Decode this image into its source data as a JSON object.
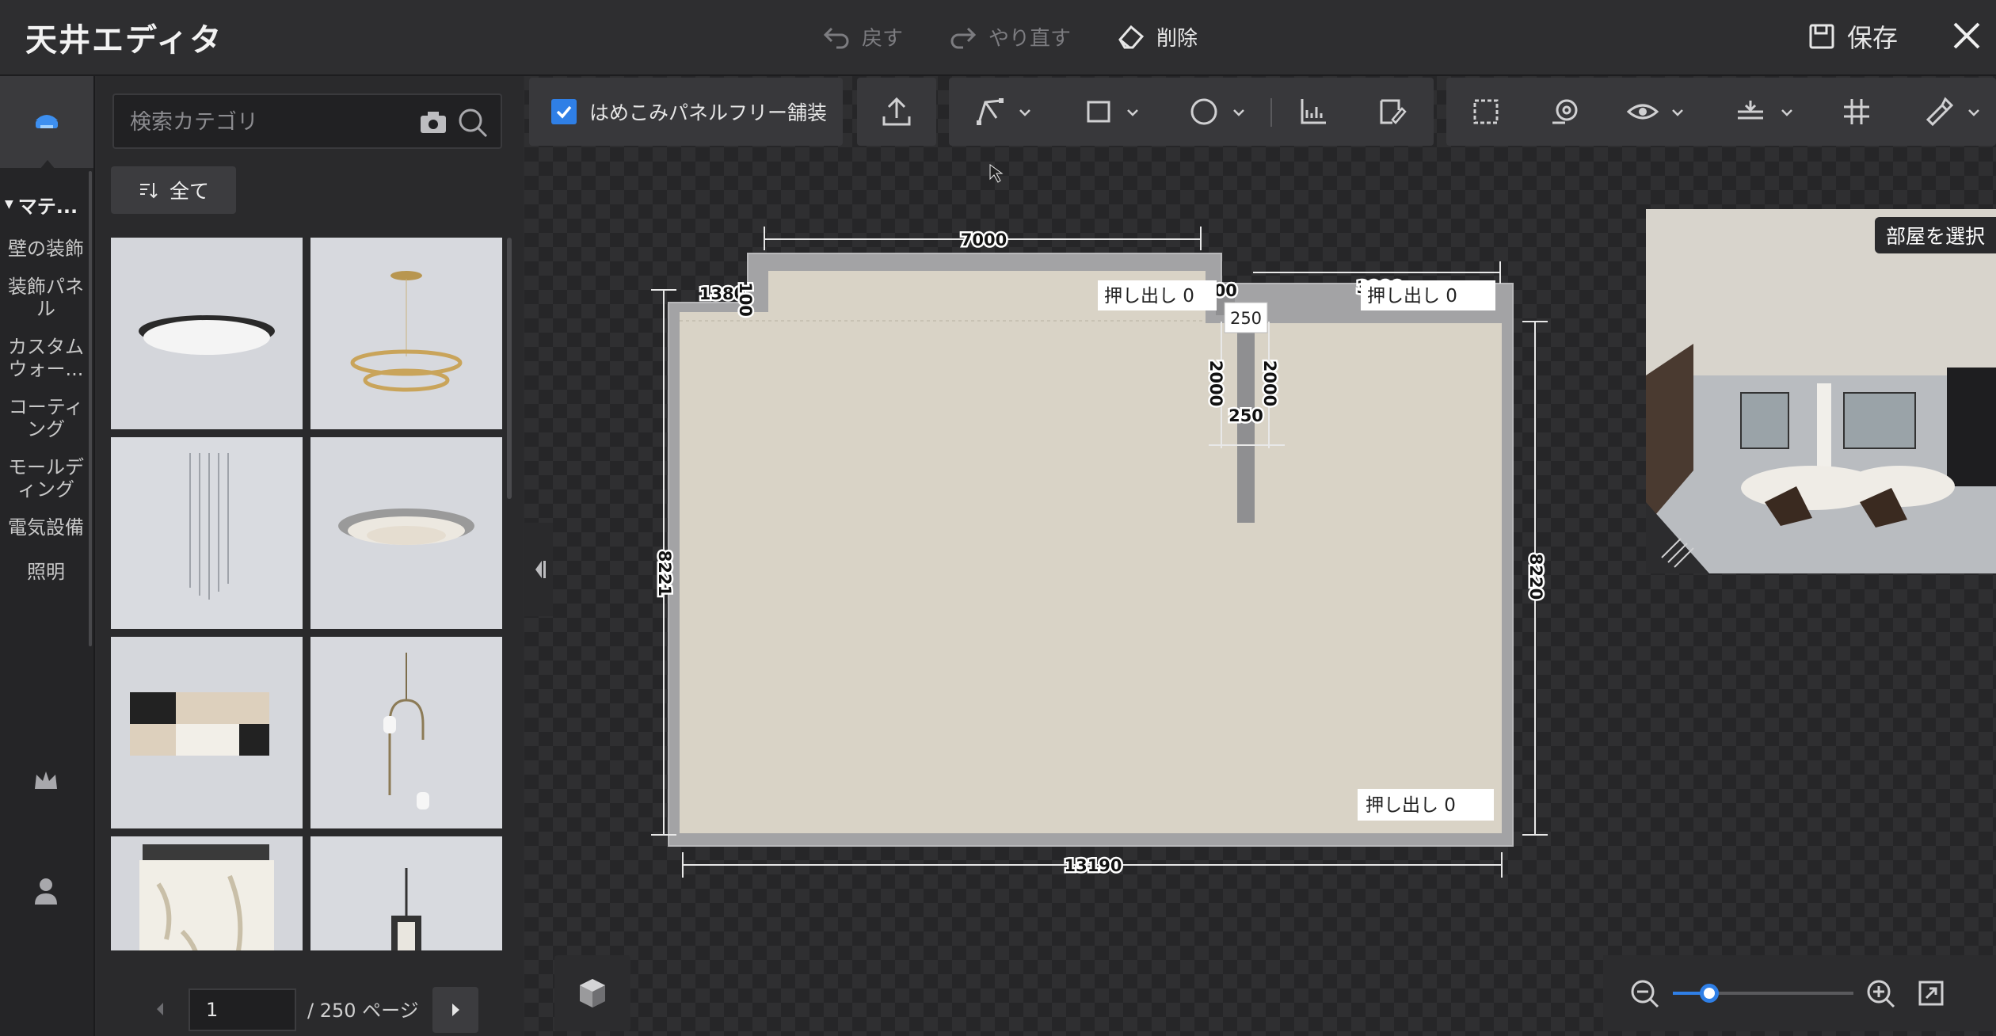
{
  "window": {
    "title": "天井エディタ",
    "undo_label": "戻す",
    "redo_label": "やり直す",
    "delete_label": "削除",
    "save_label": "保存"
  },
  "sidebar": {
    "category_header": "マテ...",
    "items": [
      {
        "label": "壁の装飾"
      },
      {
        "label": "装飾パネル"
      },
      {
        "label": "カスタムウォー..."
      },
      {
        "label": "コーティング"
      },
      {
        "label": "モールディング"
      },
      {
        "label": "電気設備"
      },
      {
        "label": "照明"
      }
    ]
  },
  "catalog": {
    "search_placeholder": "検索カテゴリ",
    "filter_label": "全て",
    "items": [
      {
        "icon": "flush-ceiling-light"
      },
      {
        "icon": "ring-chandelier"
      },
      {
        "icon": "crystal-pendant"
      },
      {
        "icon": "round-ceiling-light"
      },
      {
        "icon": "square-ceiling-light"
      },
      {
        "icon": "pendant-lamp"
      },
      {
        "icon": "floral-drum-lamp"
      },
      {
        "icon": "lantern-chandelier"
      }
    ],
    "pagination": {
      "current_page": "1",
      "total_label": "/ 250 ページ"
    }
  },
  "toolbar": {
    "paving_label": "はめこみパネルフリー舗装",
    "paving_checked": true
  },
  "plan": {
    "dimensions": {
      "top": "7000",
      "top_right": "3990",
      "left_notch_a": "1380",
      "left_notch_b": "100",
      "column_width": "600",
      "column_top": "250",
      "column_left": "2000",
      "column_right": "2000",
      "column_bottom": "250",
      "left": "8221",
      "right": "8220",
      "bottom": "13190"
    },
    "extrusion_labels": [
      "押し出し  0",
      "押し出し  0",
      "押し出し  0"
    ]
  },
  "preview": {
    "select_room_label": "部屋を選択"
  },
  "zoom": {
    "level": 0.2
  },
  "colors": {
    "accent": "#2f7fe6",
    "floor": "#d9d3c6",
    "wall": "#9c9c9e"
  }
}
